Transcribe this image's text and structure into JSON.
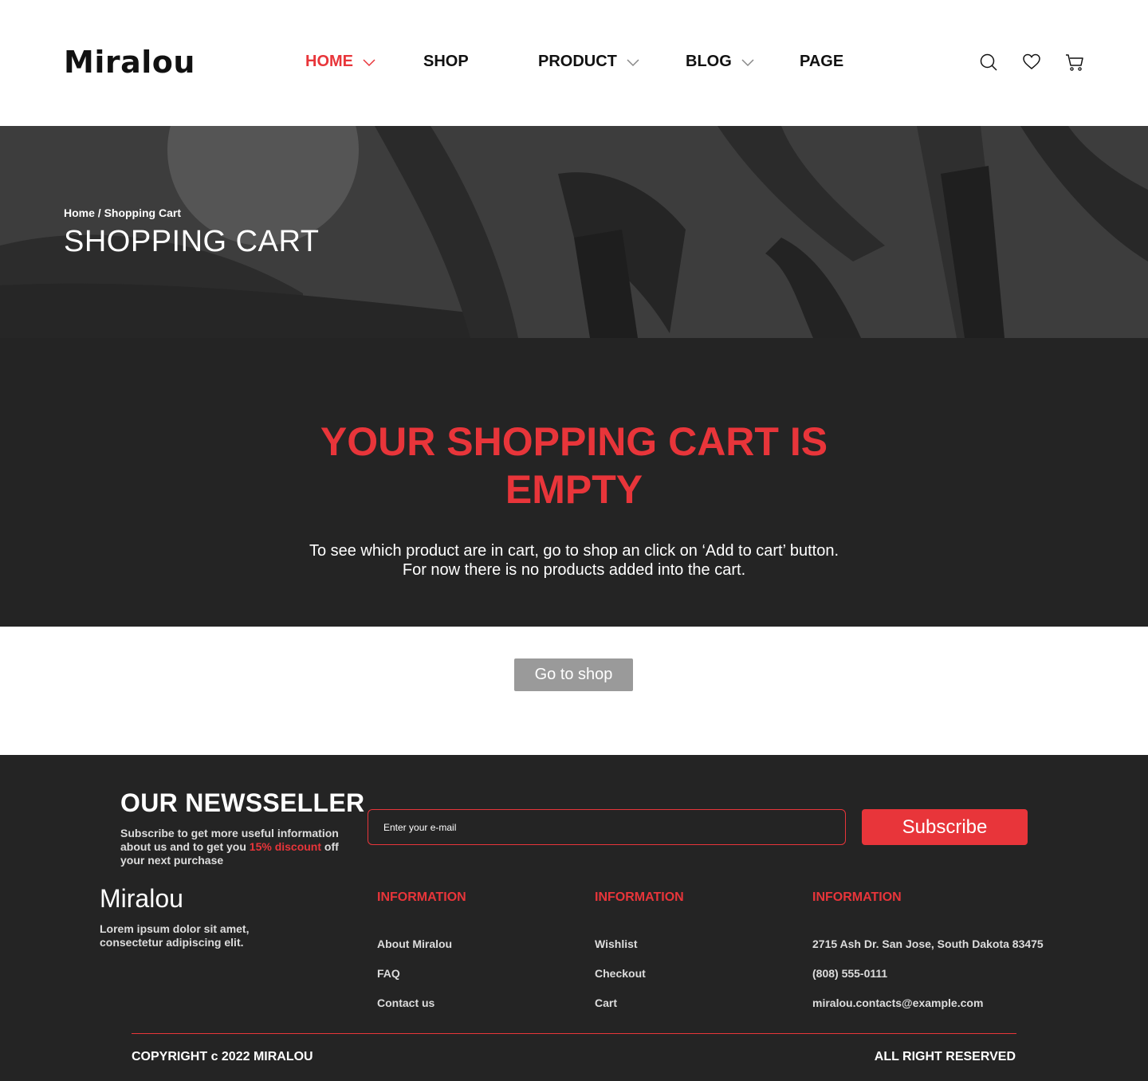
{
  "brand": {
    "name": "Miralou"
  },
  "nav": {
    "items": [
      {
        "label": "HOME",
        "has_dropdown": true,
        "active": true
      },
      {
        "label": "SHOP",
        "has_dropdown": false,
        "active": false
      },
      {
        "label": "PRODUCT",
        "has_dropdown": true,
        "active": false
      },
      {
        "label": "BLOG",
        "has_dropdown": true,
        "active": false
      },
      {
        "label": "PAGE",
        "has_dropdown": false,
        "active": false
      }
    ],
    "icons": [
      "search-icon",
      "heart-icon",
      "cart-icon"
    ]
  },
  "hero": {
    "breadcrumb": "Home / Shopping Cart",
    "title": "SHOPPING CART"
  },
  "empty_cart": {
    "title": "YOUR SHOPPING CART IS EMPTY",
    "line1": "To see which product are in cart, go to shop an click on ‘Add to cart’ button.",
    "line2": "For now there is no products added into the cart."
  },
  "go_shop_label": "Go to shop",
  "newsletter": {
    "title": "OUR NEWSSELLER",
    "text_before": "Subscribe to get more useful information about us and to get you ",
    "highlight": "15% discount",
    "text_after": " off your next purchase",
    "placeholder": "Enter your e-mail",
    "button": "Subscribe"
  },
  "footer": {
    "brand": "Miralou",
    "description": "Lorem ipsum dolor sit amet, consectetur adipiscing elit.",
    "columns": [
      {
        "title": "INFORMATION",
        "links": [
          "About Miralou",
          "FAQ",
          "Contact us"
        ]
      },
      {
        "title": "INFORMATION",
        "links": [
          "Wishlist",
          "Checkout",
          "Cart"
        ]
      },
      {
        "title": "INFORMATION",
        "links": [
          "2715 Ash Dr. San Jose, South Dakota 83475",
          "(808) 555-0111",
          "miralou.contacts@example.com"
        ]
      }
    ],
    "copyright": "COPYRIGHT c 2022 MIRALOU",
    "rights": "ALL RIGHT RESERVED"
  },
  "colors": {
    "accent": "#e8353a",
    "dark": "#242424",
    "button_gray": "#9a9a9a"
  }
}
